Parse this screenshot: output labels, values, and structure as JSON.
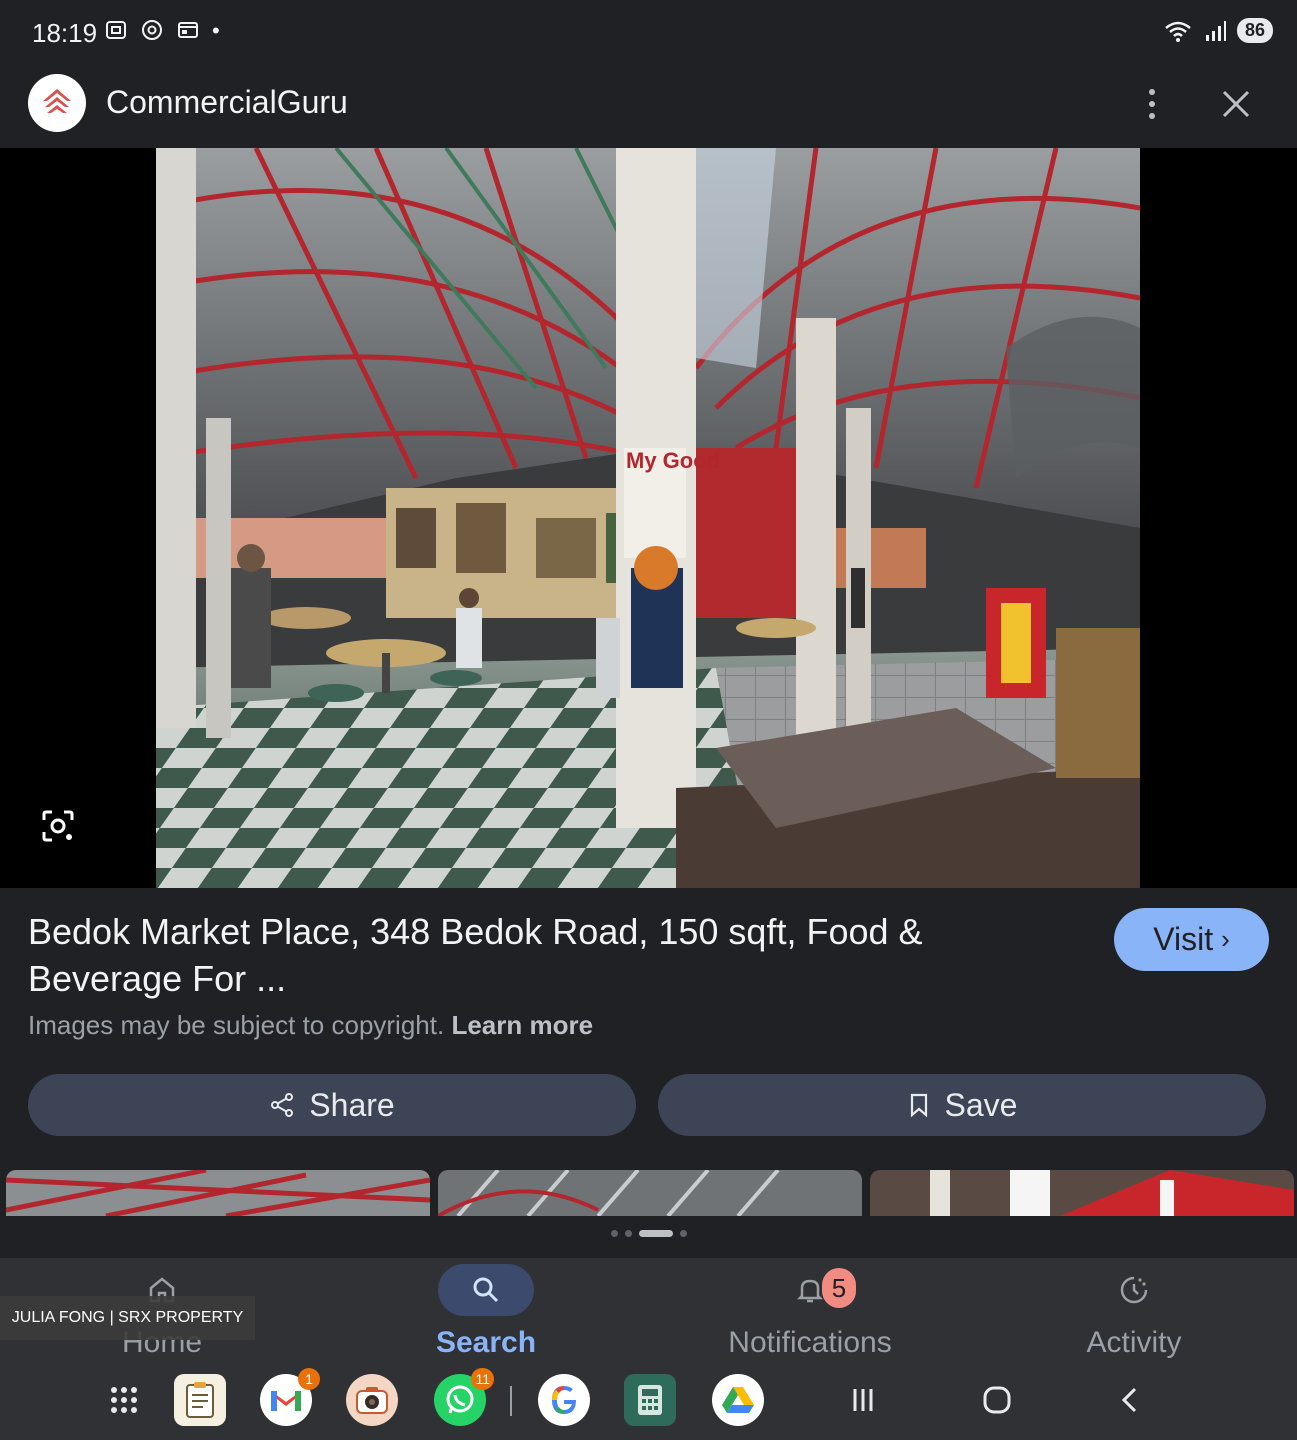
{
  "status": {
    "time": "18:19",
    "battery": "86"
  },
  "header": {
    "app_name": "CommercialGuru"
  },
  "result": {
    "title": "Bedok Market Place, 348 Bedok Road, 150 sqft, Food & Beverage For ...",
    "visit_label": "Visit",
    "copyright_text": "Images may be subject to copyright.",
    "learn_more": "Learn more",
    "share_label": "Share",
    "save_label": "Save"
  },
  "nav": {
    "items": [
      {
        "label": "Home",
        "icon": "home-icon"
      },
      {
        "label": "Search",
        "icon": "search-icon"
      },
      {
        "label": "Notifications",
        "icon": "bell-icon",
        "badge": "5"
      },
      {
        "label": "Activity",
        "icon": "activity-icon"
      }
    ]
  },
  "watermark": "JULIA FONG | SRX PROPERTY",
  "dock": {
    "gmail_badge": "1",
    "whatsapp_badge": "11"
  },
  "colors": {
    "accent": "#8ab4f8",
    "background": "#202124",
    "button": "#3c4456"
  }
}
